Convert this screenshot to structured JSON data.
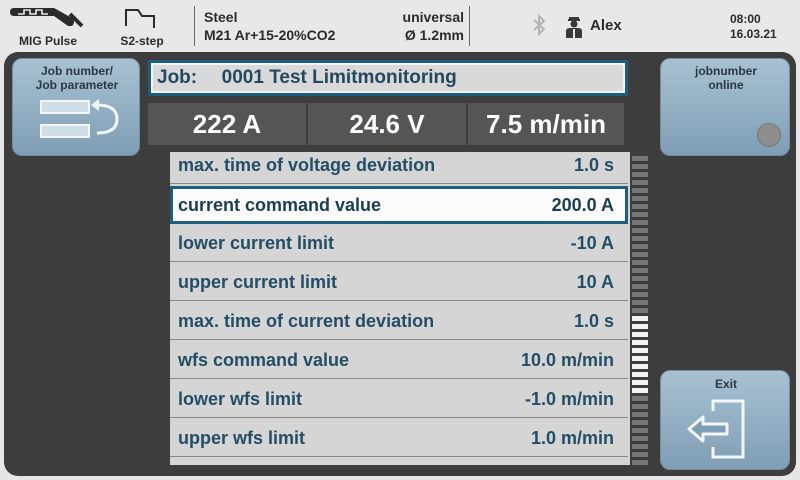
{
  "topbar": {
    "mode_label": "MIG Pulse",
    "step_label": "S2-step",
    "material_line1": "Steel",
    "material_line2": "M21 Ar+15-20%CO2",
    "wire_line1": "universal",
    "wire_line2": "Ø 1.2mm",
    "user_name": "Alex",
    "time": "08:00",
    "date": "16.03.21",
    "icons": [
      "mig-pulse-icon",
      "s2-step-icon",
      "bluetooth-icon",
      "user-icon"
    ]
  },
  "left_button": {
    "line1": "Job number/",
    "line2": "Job parameter"
  },
  "right_button": {
    "line1": "jobnumber",
    "line2": "online"
  },
  "exit_button": {
    "label": "Exit"
  },
  "job": {
    "prefix": "Job:",
    "name": "0001 Test Limitmonitoring"
  },
  "readouts": {
    "current": "222 A",
    "voltage": "24.6 V",
    "wire_speed": "7.5 m/min"
  },
  "params": [
    {
      "name": "max. time of voltage deviation",
      "value": "1.0 s"
    },
    {
      "name": "current command value",
      "value": "200.0 A",
      "selected": true
    },
    {
      "name": "lower current limit",
      "value": "-10 A"
    },
    {
      "name": "upper current limit",
      "value": "10 A"
    },
    {
      "name": "max. time of current deviation",
      "value": "1.0 s"
    },
    {
      "name": "wfs command value",
      "value": "10.0 m/min"
    },
    {
      "name": "lower wfs limit",
      "value": "-1.0 m/min"
    },
    {
      "name": "upper wfs limit",
      "value": "1.0 m/min"
    }
  ],
  "colors": {
    "accent": "#1d5d7d",
    "button": "#8fabbf",
    "panel": "#3d3d3d"
  }
}
